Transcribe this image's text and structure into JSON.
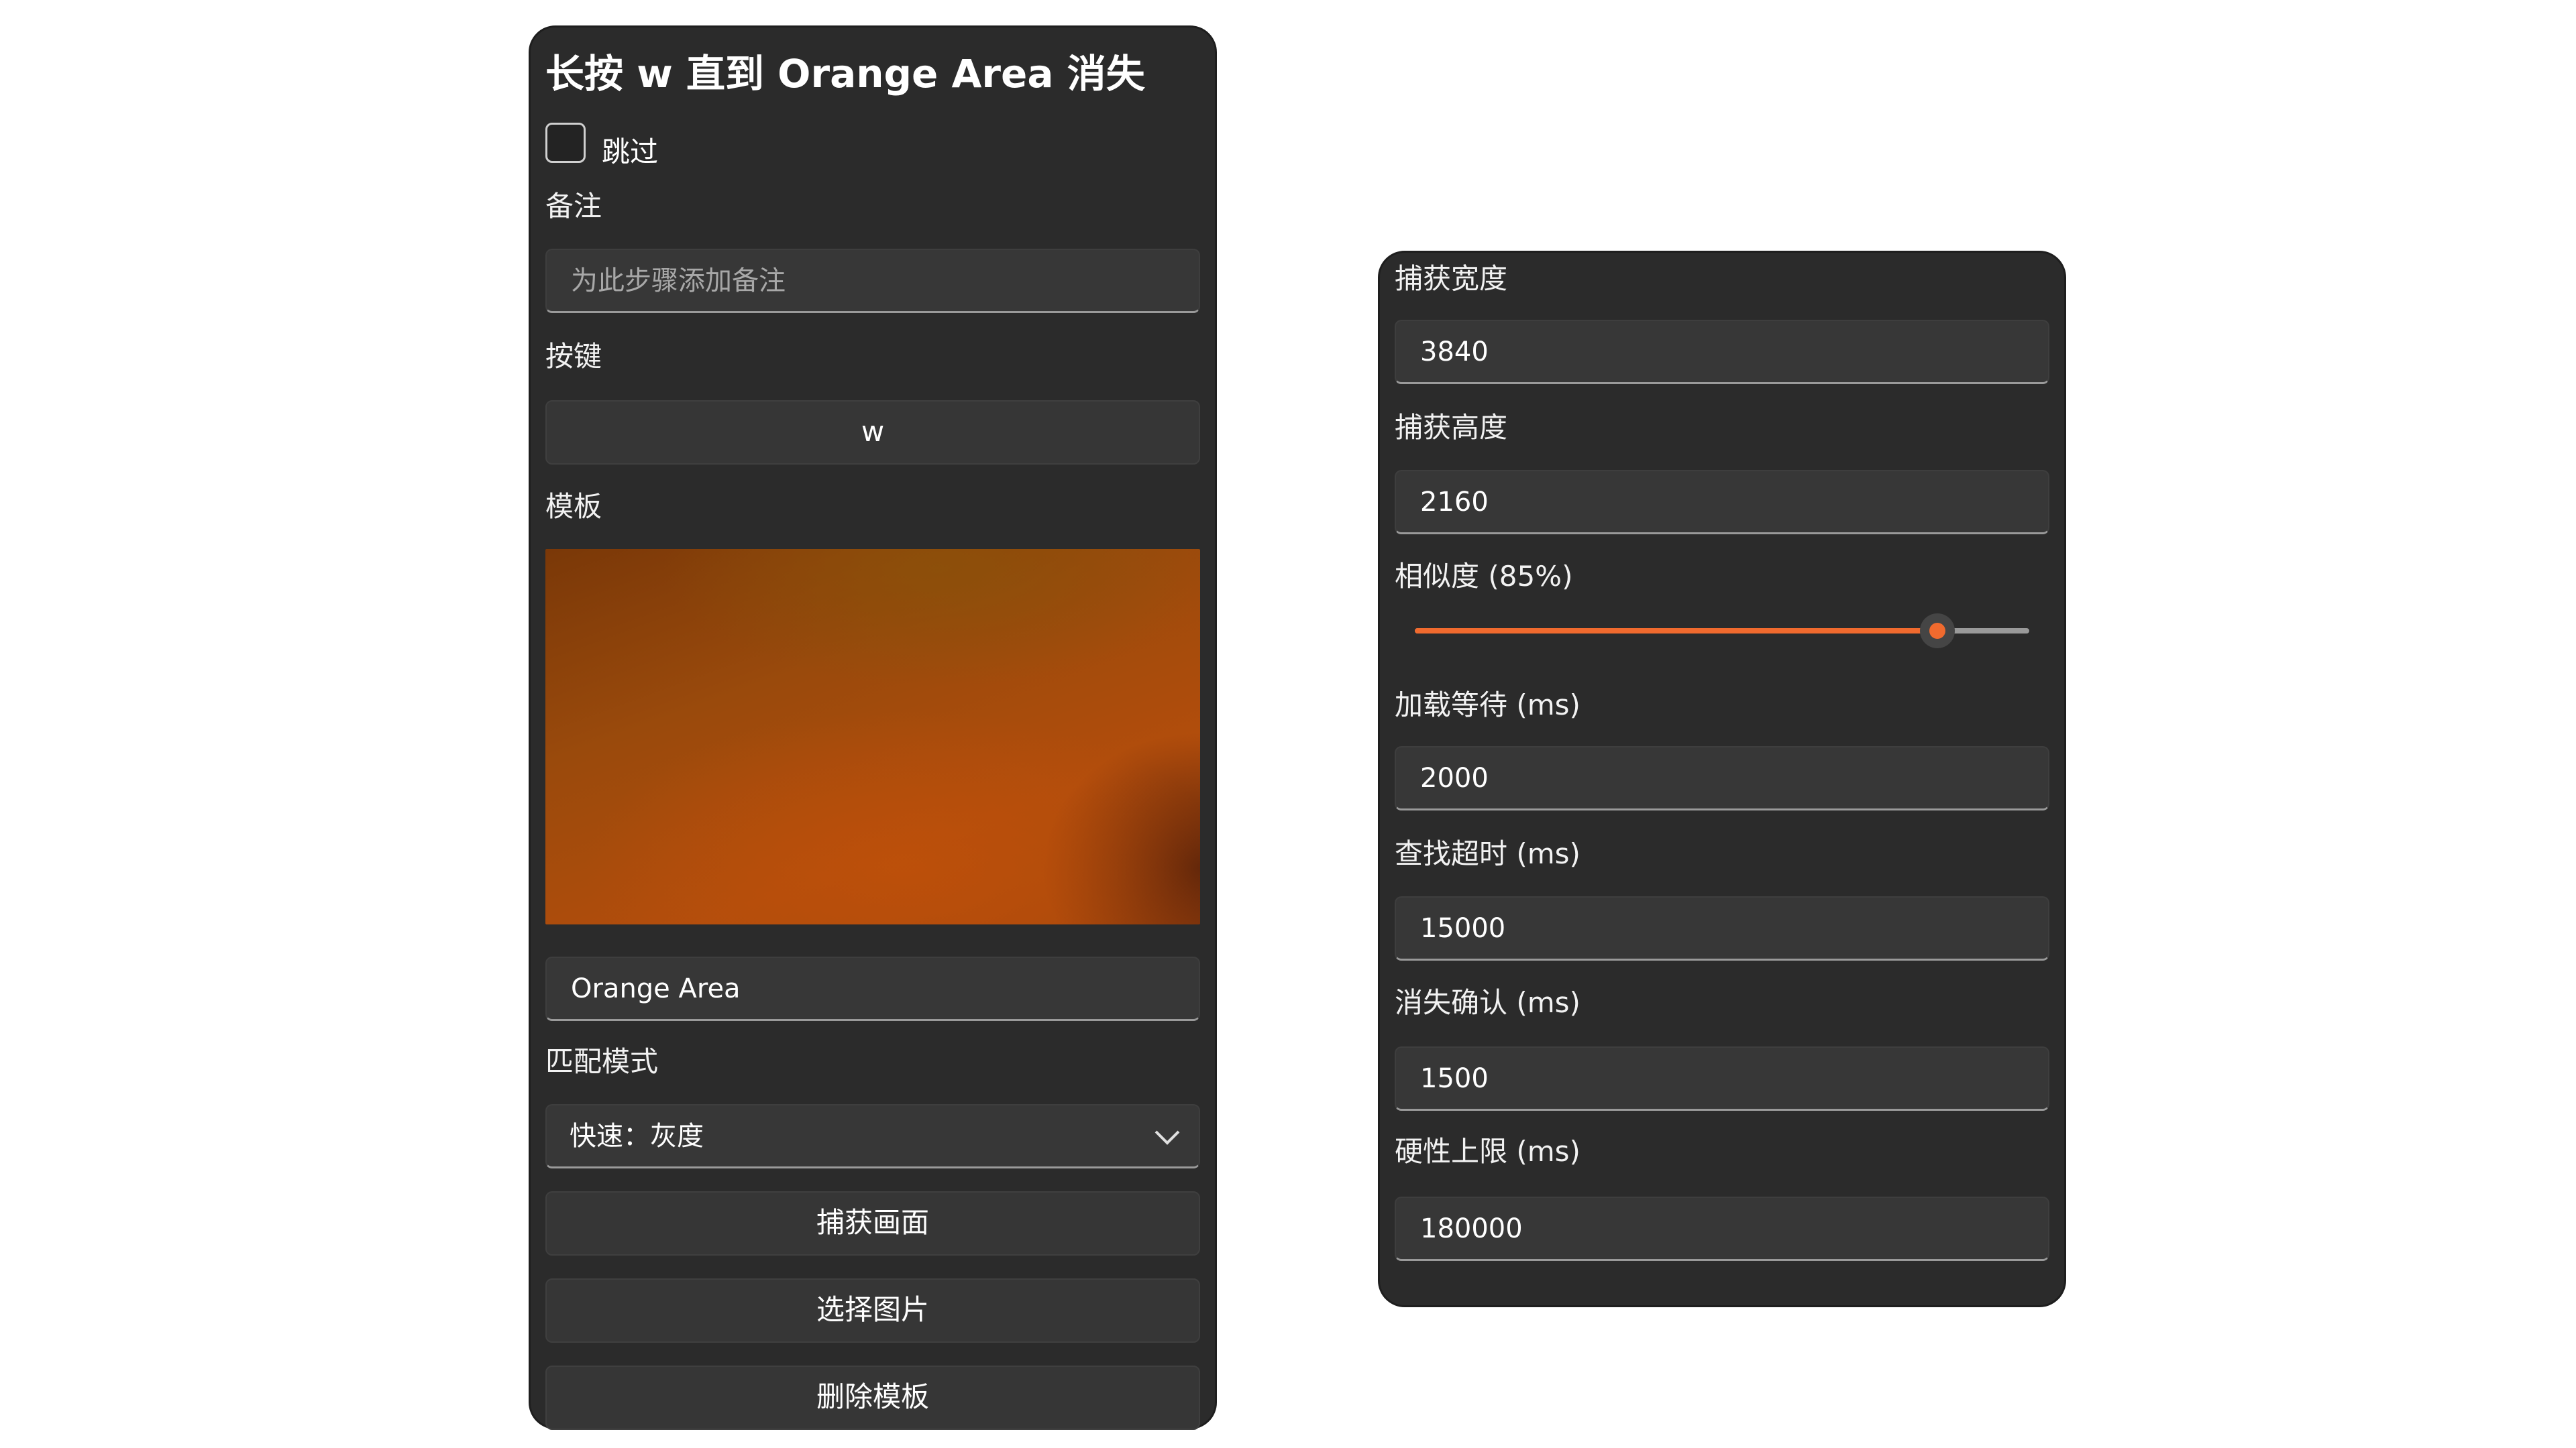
{
  "left_panel": {
    "title": "长按 w 直到 Orange Area 消失",
    "skip_label": "跳过",
    "skip_checked": false,
    "note_label": "备注",
    "note_placeholder": "为此步骤添加备注",
    "key_label": "按键",
    "key_value": "w",
    "template_label": "模板",
    "template_name": "Orange Area",
    "match_mode_label": "匹配模式",
    "match_mode_value": "快速：灰度",
    "capture_button": "捕获画面",
    "select_image_button": "选择图片",
    "delete_template_button": "删除模板"
  },
  "right_panel": {
    "capture_width_label": "捕获宽度",
    "capture_width_value": "3840",
    "capture_height_label": "捕获高度",
    "capture_height_value": "2160",
    "similarity_label": "相似度 (85%)",
    "similarity_value": 0.85,
    "load_wait_label": "加载等待 (ms)",
    "load_wait_value": "2000",
    "find_timeout_label": "查找超时 (ms)",
    "find_timeout_value": "15000",
    "disappear_confirm_label": "消失确认 (ms)",
    "disappear_confirm_value": "1500",
    "hard_limit_label": "硬性上限 (ms)",
    "hard_limit_value": "180000"
  },
  "colors": {
    "accent": "#f06a2e",
    "panel_background": "#2b2b2b"
  },
  "icons": {
    "dropdown": "chevron-down-icon"
  }
}
